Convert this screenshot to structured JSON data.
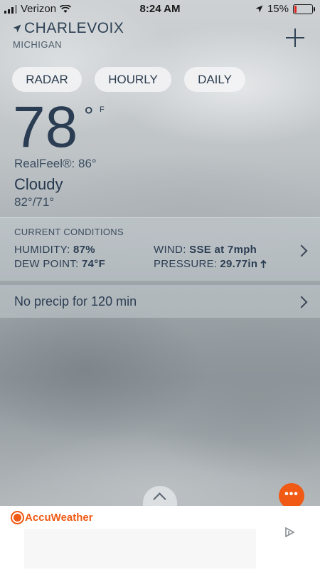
{
  "status_bar": {
    "carrier": "Verizon",
    "time": "8:24 AM",
    "battery": "15%",
    "battery_level": 0.15
  },
  "location": {
    "city": "CHARLEVOIX",
    "state": "MICHIGAN"
  },
  "tabs": [
    {
      "label": "RADAR"
    },
    {
      "label": "HOURLY"
    },
    {
      "label": "DAILY"
    }
  ],
  "current": {
    "temperature": "78",
    "degree_symbol": "°",
    "unit": "F",
    "realfeel": "RealFeel®: 86°",
    "condition": "Cloudy",
    "hi_lo": "82°/71°"
  },
  "conditions": {
    "title": "CURRENT CONDITIONS",
    "humidity_label": "HUMIDITY:",
    "humidity_value": "87%",
    "dewpoint_label": "DEW POINT:",
    "dewpoint_value": "74°F",
    "wind_label": "WIND:",
    "wind_value": "SSE at 7mph",
    "pressure_label": "PRESSURE:",
    "pressure_value": "29.77in"
  },
  "precip": {
    "text": "No precip for 120 min"
  },
  "more_button": "•••",
  "brand": {
    "name": "AccuWeather",
    "color": "#f05a14"
  },
  "icons": [
    "wifi-icon",
    "location-arrow-icon",
    "add-icon",
    "chevron-right-icon",
    "chevron-up-icon",
    "more-icon",
    "adchoices-icon",
    "pressure-up-arrow-icon"
  ]
}
